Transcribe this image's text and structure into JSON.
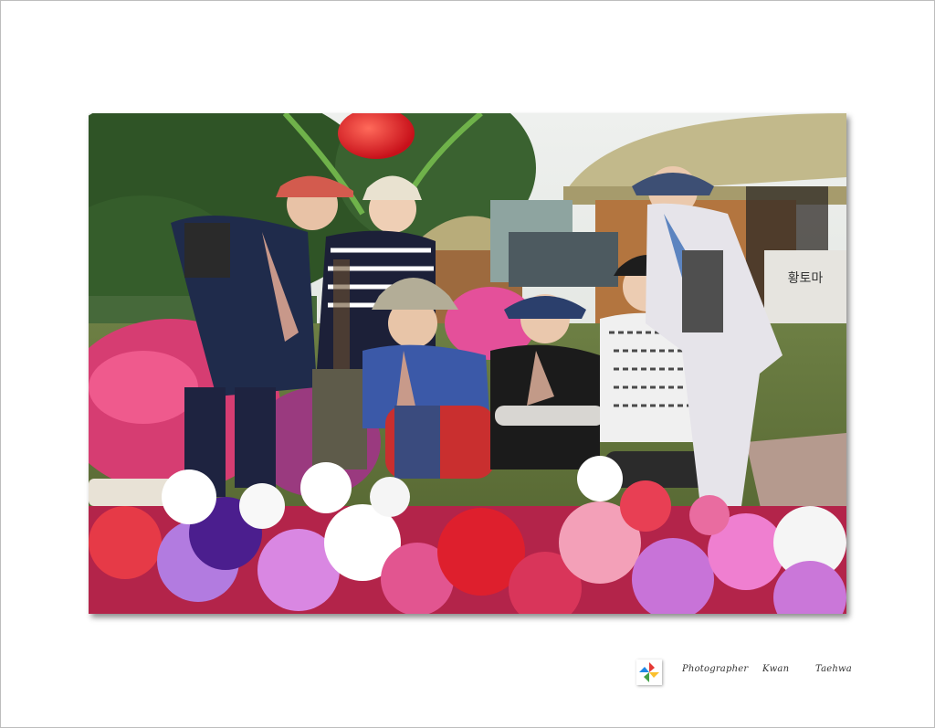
{
  "photo": {
    "description_icon": "group-photo-flower-garden",
    "sign_text": "황토마"
  },
  "signature": {
    "logo_icon": "pinwheel-logo-icon",
    "words": [
      "Photographer",
      "Kwan",
      "Taehwa"
    ]
  },
  "colors": {
    "frame_border": "#bdbdbd",
    "background": "#ffffff"
  }
}
